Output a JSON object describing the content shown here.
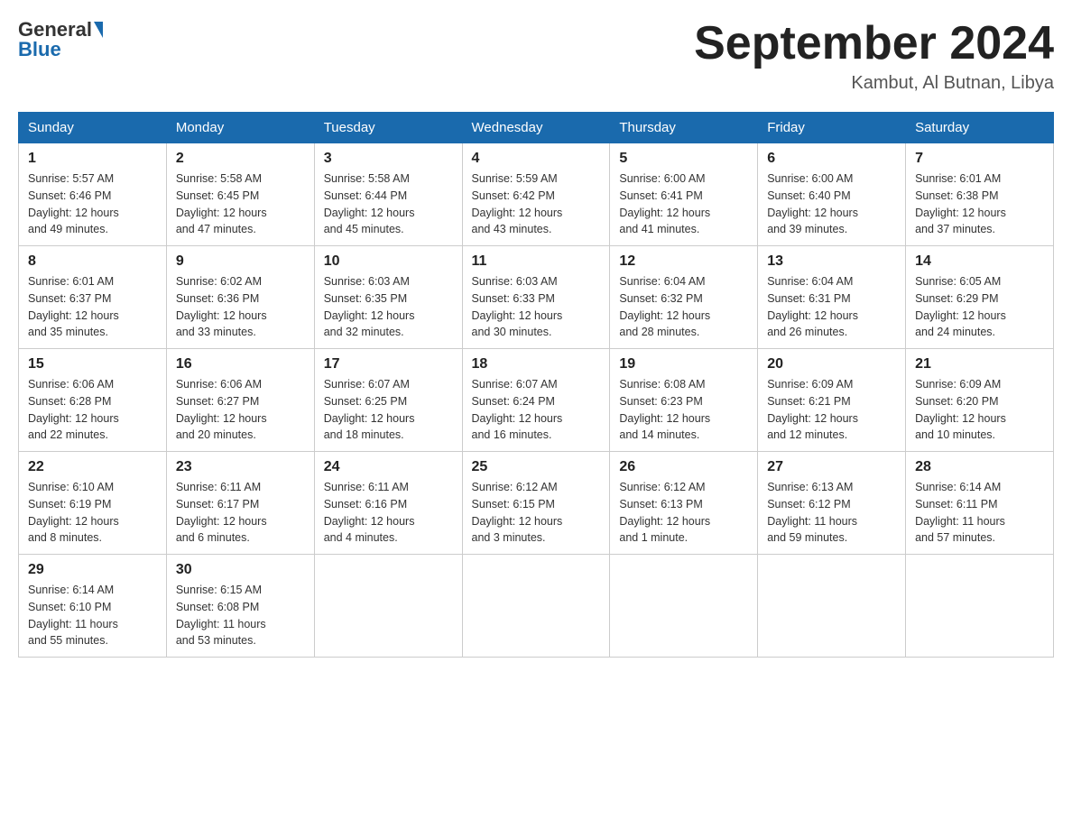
{
  "header": {
    "logo_general": "General",
    "logo_blue": "Blue",
    "month_year": "September 2024",
    "location": "Kambut, Al Butnan, Libya"
  },
  "weekdays": [
    "Sunday",
    "Monday",
    "Tuesday",
    "Wednesday",
    "Thursday",
    "Friday",
    "Saturday"
  ],
  "weeks": [
    [
      {
        "day": "1",
        "sunrise": "5:57 AM",
        "sunset": "6:46 PM",
        "daylight": "12 hours and 49 minutes."
      },
      {
        "day": "2",
        "sunrise": "5:58 AM",
        "sunset": "6:45 PM",
        "daylight": "12 hours and 47 minutes."
      },
      {
        "day": "3",
        "sunrise": "5:58 AM",
        "sunset": "6:44 PM",
        "daylight": "12 hours and 45 minutes."
      },
      {
        "day": "4",
        "sunrise": "5:59 AM",
        "sunset": "6:42 PM",
        "daylight": "12 hours and 43 minutes."
      },
      {
        "day": "5",
        "sunrise": "6:00 AM",
        "sunset": "6:41 PM",
        "daylight": "12 hours and 41 minutes."
      },
      {
        "day": "6",
        "sunrise": "6:00 AM",
        "sunset": "6:40 PM",
        "daylight": "12 hours and 39 minutes."
      },
      {
        "day": "7",
        "sunrise": "6:01 AM",
        "sunset": "6:38 PM",
        "daylight": "12 hours and 37 minutes."
      }
    ],
    [
      {
        "day": "8",
        "sunrise": "6:01 AM",
        "sunset": "6:37 PM",
        "daylight": "12 hours and 35 minutes."
      },
      {
        "day": "9",
        "sunrise": "6:02 AM",
        "sunset": "6:36 PM",
        "daylight": "12 hours and 33 minutes."
      },
      {
        "day": "10",
        "sunrise": "6:03 AM",
        "sunset": "6:35 PM",
        "daylight": "12 hours and 32 minutes."
      },
      {
        "day": "11",
        "sunrise": "6:03 AM",
        "sunset": "6:33 PM",
        "daylight": "12 hours and 30 minutes."
      },
      {
        "day": "12",
        "sunrise": "6:04 AM",
        "sunset": "6:32 PM",
        "daylight": "12 hours and 28 minutes."
      },
      {
        "day": "13",
        "sunrise": "6:04 AM",
        "sunset": "6:31 PM",
        "daylight": "12 hours and 26 minutes."
      },
      {
        "day": "14",
        "sunrise": "6:05 AM",
        "sunset": "6:29 PM",
        "daylight": "12 hours and 24 minutes."
      }
    ],
    [
      {
        "day": "15",
        "sunrise": "6:06 AM",
        "sunset": "6:28 PM",
        "daylight": "12 hours and 22 minutes."
      },
      {
        "day": "16",
        "sunrise": "6:06 AM",
        "sunset": "6:27 PM",
        "daylight": "12 hours and 20 minutes."
      },
      {
        "day": "17",
        "sunrise": "6:07 AM",
        "sunset": "6:25 PM",
        "daylight": "12 hours and 18 minutes."
      },
      {
        "day": "18",
        "sunrise": "6:07 AM",
        "sunset": "6:24 PM",
        "daylight": "12 hours and 16 minutes."
      },
      {
        "day": "19",
        "sunrise": "6:08 AM",
        "sunset": "6:23 PM",
        "daylight": "12 hours and 14 minutes."
      },
      {
        "day": "20",
        "sunrise": "6:09 AM",
        "sunset": "6:21 PM",
        "daylight": "12 hours and 12 minutes."
      },
      {
        "day": "21",
        "sunrise": "6:09 AM",
        "sunset": "6:20 PM",
        "daylight": "12 hours and 10 minutes."
      }
    ],
    [
      {
        "day": "22",
        "sunrise": "6:10 AM",
        "sunset": "6:19 PM",
        "daylight": "12 hours and 8 minutes."
      },
      {
        "day": "23",
        "sunrise": "6:11 AM",
        "sunset": "6:17 PM",
        "daylight": "12 hours and 6 minutes."
      },
      {
        "day": "24",
        "sunrise": "6:11 AM",
        "sunset": "6:16 PM",
        "daylight": "12 hours and 4 minutes."
      },
      {
        "day": "25",
        "sunrise": "6:12 AM",
        "sunset": "6:15 PM",
        "daylight": "12 hours and 3 minutes."
      },
      {
        "day": "26",
        "sunrise": "6:12 AM",
        "sunset": "6:13 PM",
        "daylight": "12 hours and 1 minute."
      },
      {
        "day": "27",
        "sunrise": "6:13 AM",
        "sunset": "6:12 PM",
        "daylight": "11 hours and 59 minutes."
      },
      {
        "day": "28",
        "sunrise": "6:14 AM",
        "sunset": "6:11 PM",
        "daylight": "11 hours and 57 minutes."
      }
    ],
    [
      {
        "day": "29",
        "sunrise": "6:14 AM",
        "sunset": "6:10 PM",
        "daylight": "11 hours and 55 minutes."
      },
      {
        "day": "30",
        "sunrise": "6:15 AM",
        "sunset": "6:08 PM",
        "daylight": "11 hours and 53 minutes."
      },
      null,
      null,
      null,
      null,
      null
    ]
  ],
  "labels": {
    "sunrise_prefix": "Sunrise: ",
    "sunset_prefix": "Sunset: ",
    "daylight_prefix": "Daylight: "
  }
}
